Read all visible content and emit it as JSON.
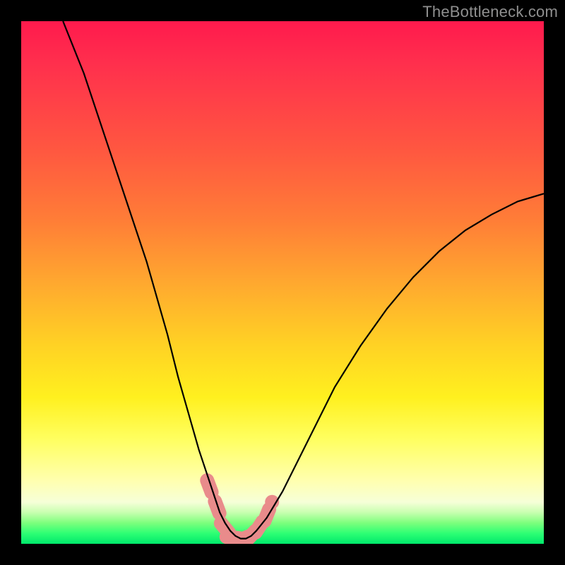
{
  "watermark": "TheBottleneck.com",
  "chart_data": {
    "type": "line",
    "title": "",
    "xlabel": "",
    "ylabel": "",
    "xlim": [
      0,
      100
    ],
    "ylim": [
      0,
      100
    ],
    "grid": false,
    "legend": false,
    "series": [
      {
        "name": "bottleneck-curve",
        "color": "#000000",
        "x": [
          8,
          12,
          16,
          20,
          24,
          28,
          30,
          32,
          34,
          36,
          37,
          38,
          39,
          40,
          41,
          42,
          43,
          44,
          45,
          47,
          50,
          55,
          60,
          65,
          70,
          75,
          80,
          85,
          90,
          95,
          100
        ],
        "y": [
          100,
          90,
          78,
          66,
          54,
          40,
          32,
          25,
          18,
          12,
          9,
          6,
          4,
          2.5,
          1.5,
          1,
          1,
          1.5,
          2.5,
          5,
          10,
          20,
          30,
          38,
          45,
          51,
          56,
          60,
          63,
          65.5,
          67
        ]
      }
    ],
    "markers": [
      {
        "name": "highlight-points",
        "color": "#e98b8b",
        "shape": "round-cap-segment",
        "points": [
          {
            "x": 36,
            "y": 11
          },
          {
            "x": 37.5,
            "y": 7
          },
          {
            "x": 39,
            "y": 3
          },
          {
            "x": 40.5,
            "y": 1.2
          },
          {
            "x": 42.5,
            "y": 1.0
          },
          {
            "x": 44,
            "y": 1.6
          },
          {
            "x": 45.5,
            "y": 3.2
          },
          {
            "x": 47,
            "y": 5.5
          },
          {
            "x": 48,
            "y": 8
          }
        ]
      }
    ],
    "background_gradient": {
      "top": "#ff1a4d",
      "mid": "#ffd224",
      "bottom": "#00e86b"
    }
  }
}
